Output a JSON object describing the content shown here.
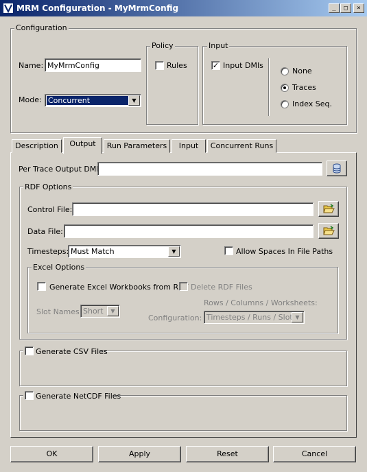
{
  "window": {
    "title": "MRM Configuration - MyMrmConfig",
    "min_glyph": "_",
    "max_glyph": "□",
    "close_glyph": "×"
  },
  "configuration": {
    "legend": "Configuration",
    "name_label": "Name:",
    "name_value": "MyMrmConfig",
    "mode_label": "Mode:",
    "mode_value": "Concurrent",
    "policy": {
      "legend": "Policy",
      "rules_label": "Rules",
      "rules_checked": false
    },
    "input": {
      "legend": "Input",
      "input_dmis_label": "Input DMIs",
      "input_dmis_checked": true,
      "options": [
        "None",
        "Traces",
        "Index Seq."
      ],
      "selected": "Traces"
    }
  },
  "tabs": [
    "Description",
    "Output",
    "Run Parameters",
    "Input",
    "Concurrent Runs"
  ],
  "active_tab": "Output",
  "output": {
    "per_trace_label": "Per Trace Output DMI:",
    "per_trace_value": "",
    "rdf": {
      "legend": "RDF Options",
      "control_file_label": "Control File:",
      "control_file_value": "",
      "data_file_label": "Data File:",
      "data_file_value": "",
      "timesteps_label": "Timesteps:",
      "timesteps_value": "Must Match",
      "allow_spaces_label": "Allow Spaces In File Paths",
      "allow_spaces_checked": false,
      "excel": {
        "legend": "Excel Options",
        "generate_label": "Generate Excel Workbooks from RDF",
        "generate_checked": false,
        "delete_label": "Delete RDF Files",
        "delete_checked": false,
        "slot_names_label": "Slot Names:",
        "slot_names_value": "Short",
        "rows_cols_label": "Rows / Columns / Worksheets:",
        "configuration_label": "Configuration:",
        "configuration_value": "Timesteps / Runs / Slots"
      }
    },
    "csv": {
      "label": "Generate CSV Files",
      "checked": false
    },
    "netcdf": {
      "label": "Generate NetCDF Files",
      "checked": false
    }
  },
  "buttons": {
    "ok": "OK",
    "apply": "Apply",
    "reset": "Reset",
    "cancel": "Cancel"
  },
  "colors": {
    "face": "#d4d0c8",
    "title_start": "#0a246a",
    "title_end": "#a6caf0",
    "selection": "#0a246a"
  }
}
